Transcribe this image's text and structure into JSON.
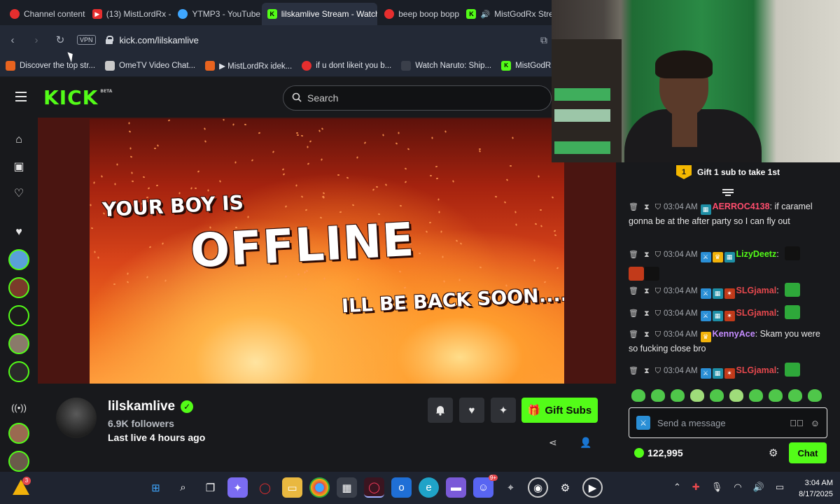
{
  "browser": {
    "tabs": [
      {
        "label": "Channel content",
        "color": "#e62e2e"
      },
      {
        "label": "(13) MistLordRx -",
        "color": "#e62e2e"
      },
      {
        "label": "YTMP3 - YouTube",
        "color": "#3fa7ff"
      },
      {
        "label": "lilskamlive Stream - Watch",
        "color": "#53fc18",
        "active": true
      },
      {
        "label": "beep boop bopp",
        "color": "#e62e2e"
      },
      {
        "label": "MistGodRx Stre",
        "color": "#53fc18"
      }
    ],
    "url": "kick.com/lilskamlive",
    "vpn_label": "VPN",
    "bookmarks": [
      {
        "label": "Discover the top str...",
        "color": "#e8631f"
      },
      {
        "label": "OmeTV Video Chat...",
        "color": "#c9c9c9"
      },
      {
        "label": "▶ MistLordRx idek...",
        "color": "#e8631f"
      },
      {
        "label": "if u dont likeit you b...",
        "color": "#e62e2e"
      },
      {
        "label": "Watch Naruto: Ship...",
        "color": "#3a3f4a"
      },
      {
        "label": "MistGodR",
        "color": "#53fc18"
      }
    ]
  },
  "kick": {
    "logo": "KICK",
    "logo_badge": "BETA",
    "search_placeholder": "Search",
    "offline_banner": {
      "line1": "YOUR BOY IS",
      "line2": "OFFLINE",
      "line3": "ILL BE BACK SOON...."
    },
    "channel": {
      "name": "lilskamlive",
      "followers": "6.9K followers",
      "last_live": "Last live 4 hours ago",
      "gift_label": "Gift Subs"
    },
    "accent": "#53fc18"
  },
  "chat": {
    "gift_banner": "Gift 1 sub to take 1st",
    "gift_rank": "1",
    "messages": [
      {
        "time": "03:04 AM",
        "user": "AERROC4138",
        "user_color": "#ff4d6d",
        "text": ": if caramel gonna be at the after party so I can fly out"
      },
      {
        "time": "03:04 AM",
        "user": "LizyDeetz",
        "user_color": "#53fc18",
        "text": ":"
      },
      {
        "time": "03:04 AM",
        "user": "SLGjamal",
        "user_color": "#e5484d",
        "text": ":"
      },
      {
        "time": "03:04 AM",
        "user": "SLGjamal",
        "user_color": "#e5484d",
        "text": ":"
      },
      {
        "time": "03:04 AM",
        "user": "KennyAce",
        "user_color": "#c48cff",
        "text": ": Skam you were so fucking close bro"
      },
      {
        "time": "03:04 AM",
        "user": "SLGjamal",
        "user_color": "#e5484d",
        "text": ":"
      }
    ],
    "input_placeholder": "Send a message",
    "points": "122,995",
    "chat_button": "Chat"
  },
  "taskbar": {
    "notification_count": "3",
    "discord_badge": "9+",
    "time": "3:04 AM",
    "date": "8/17/2025"
  }
}
